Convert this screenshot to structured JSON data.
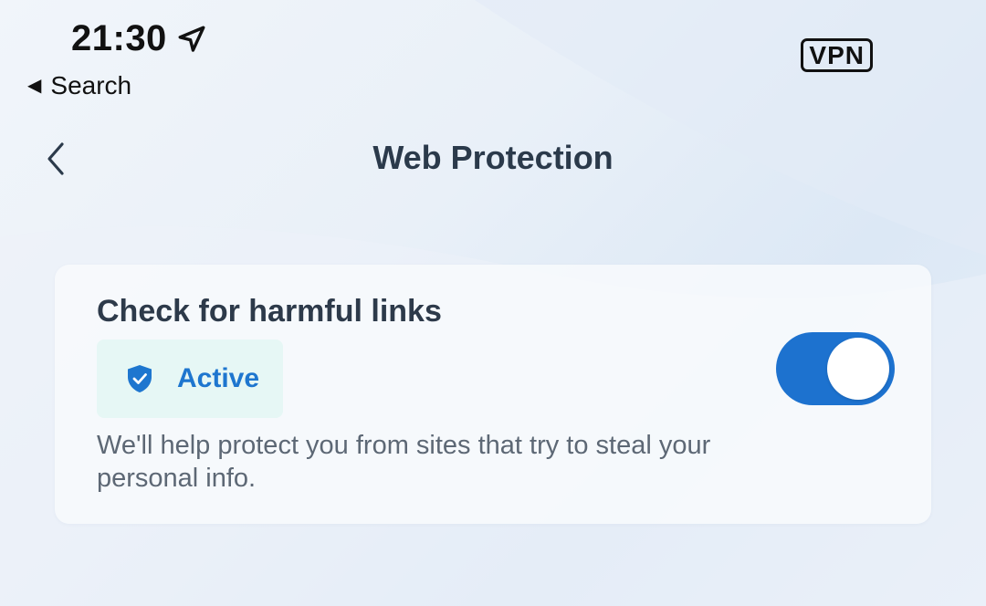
{
  "status_bar": {
    "time": "21:30",
    "back_app_label": "Search",
    "vpn_label": "VPN",
    "location_icon": "location-arrow-icon"
  },
  "nav": {
    "title": "Web Protection",
    "back_icon": "chevron-left-icon"
  },
  "card": {
    "title": "Check for harmful links",
    "status": "Active",
    "status_icon": "shield-check-icon",
    "description": "We'll help protect you from sites that try to steal your personal info.",
    "toggle_on": true
  },
  "colors": {
    "accent": "#1d72cf",
    "status_text": "#1e76cf",
    "status_bg": "#e6f7f5",
    "title_text": "#2d3a4a",
    "description_text": "#5d6875"
  }
}
